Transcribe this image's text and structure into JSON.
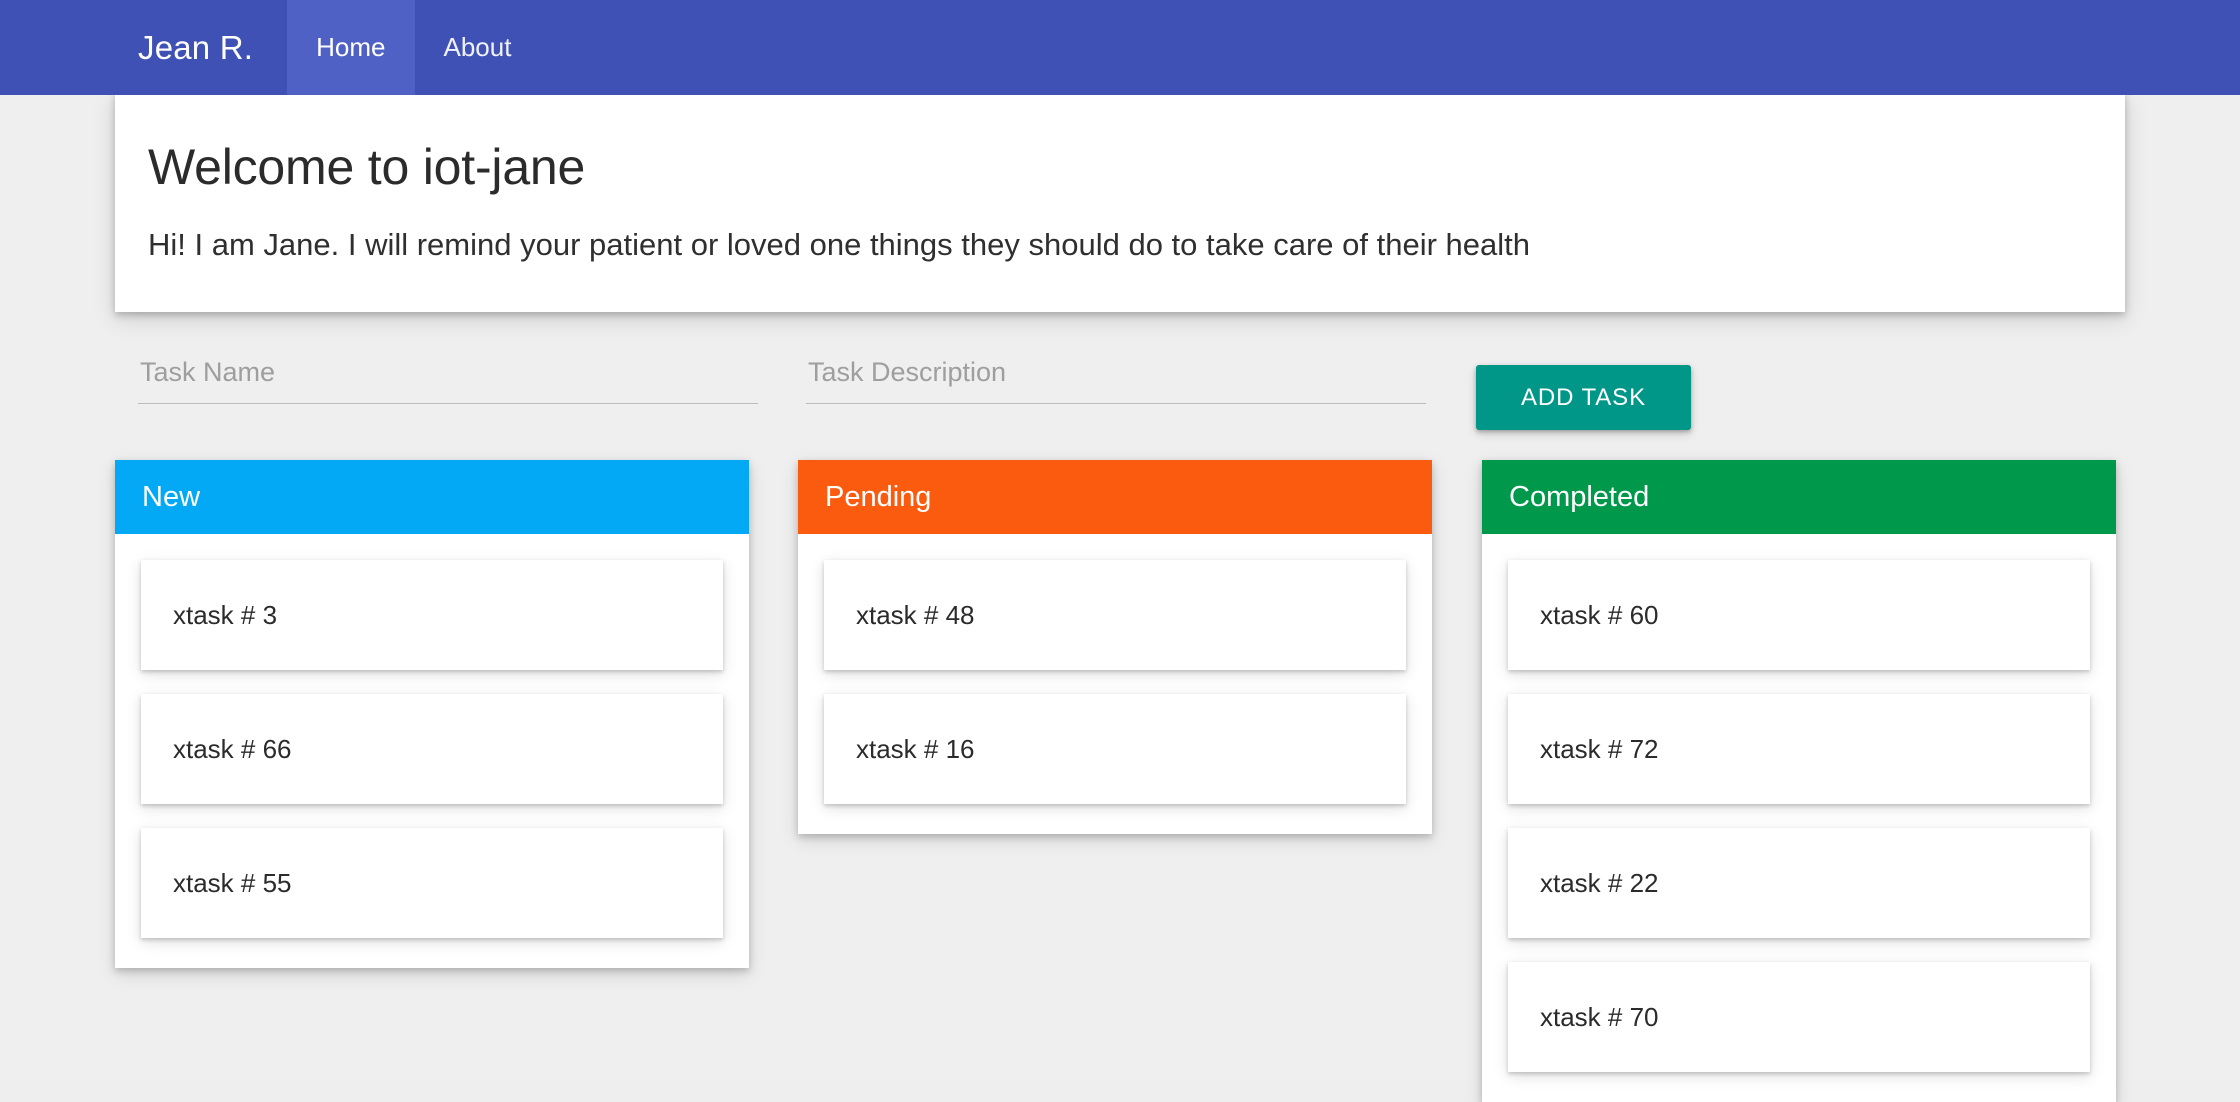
{
  "navbar": {
    "brand": "Jean R.",
    "items": [
      {
        "label": "Home",
        "active": true
      },
      {
        "label": "About",
        "active": false
      }
    ],
    "background_color": "#3f51b5",
    "active_item_color": "#4f61c4"
  },
  "welcome": {
    "title": "Welcome to iot-jane",
    "subtitle": "Hi! I am Jane. I will remind your patient or loved one things they should do to take care of their health"
  },
  "form": {
    "task_name": {
      "placeholder": "Task Name",
      "value": ""
    },
    "task_description": {
      "placeholder": "Task Description",
      "value": ""
    },
    "add_button_label": "ADD TASK",
    "add_button_color": "#009688"
  },
  "board": {
    "columns": [
      {
        "title": "New",
        "color": "#03a9f4",
        "tasks": [
          {
            "label": "xtask # 3"
          },
          {
            "label": "xtask # 66"
          },
          {
            "label": "xtask # 55"
          }
        ]
      },
      {
        "title": "Pending",
        "color": "#fa5b0f",
        "tasks": [
          {
            "label": "xtask # 48"
          },
          {
            "label": "xtask # 16"
          }
        ]
      },
      {
        "title": "Completed",
        "color": "#00994c",
        "tasks": [
          {
            "label": "xtask # 60"
          },
          {
            "label": "xtask # 72"
          },
          {
            "label": "xtask # 22"
          },
          {
            "label": "xtask # 70"
          }
        ]
      }
    ]
  }
}
